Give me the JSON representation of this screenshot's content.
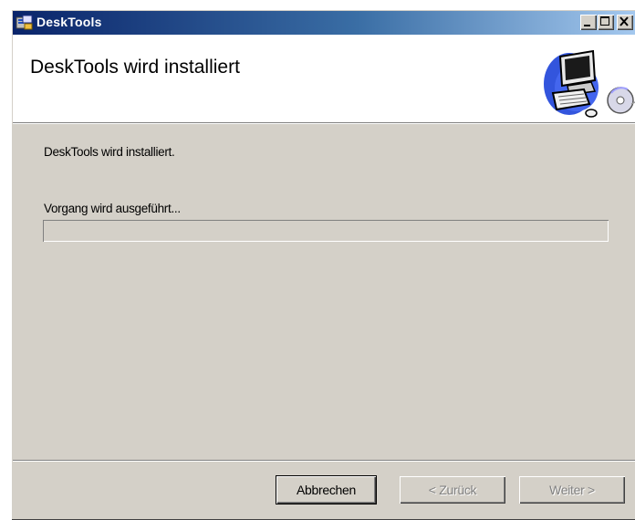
{
  "window": {
    "title": "DeskTools",
    "title_icon": "installer-app-icon",
    "controls": [
      "minimize-icon",
      "maximize-icon",
      "close-icon"
    ]
  },
  "header": {
    "title": "DeskTools wird installiert",
    "banner_icon": "computer-install-icon"
  },
  "body": {
    "status_text": "DeskTools wird installiert.",
    "progress_label": "Vorgang wird ausgeführt...",
    "progress_value": 0
  },
  "buttons": {
    "cancel_label": "Abbrechen",
    "back_label": "< Zurück",
    "next_label": "Weiter >"
  },
  "colors": {
    "titlebar": "#0a246a",
    "dialog_face": "#d4d0c8"
  }
}
